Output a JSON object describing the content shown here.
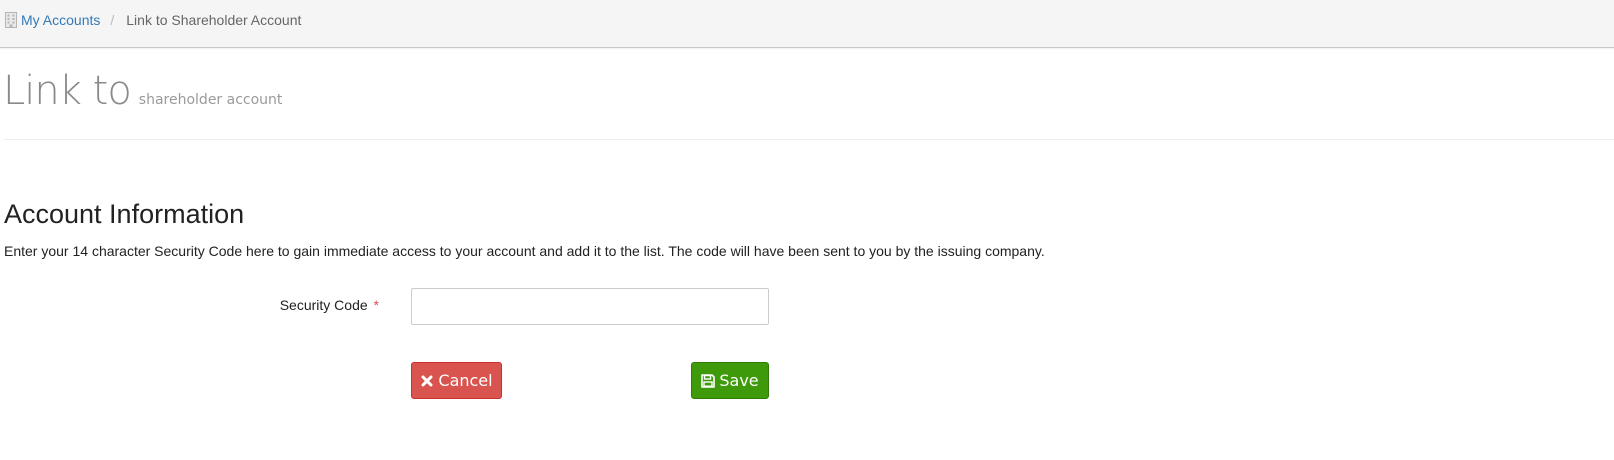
{
  "breadcrumb": {
    "icon": "building-icon",
    "home_label": "My Accounts",
    "separator": "/",
    "current_label": "Link to Shareholder Account"
  },
  "page": {
    "title": "Link to",
    "subtitle": "shareholder account"
  },
  "section": {
    "title": "Account Information",
    "description": "Enter your 14 character Security Code here to gain immediate access to your account and add it to the list. The code will have been sent to you by the issuing company."
  },
  "form": {
    "security_code": {
      "label": "Security Code",
      "required_mark": "*",
      "value": "",
      "placeholder": ""
    }
  },
  "actions": {
    "cancel": {
      "label": "Cancel",
      "icon": "times-icon",
      "color": "#d9534f"
    },
    "save": {
      "label": "Save",
      "icon": "floppy-disk-icon",
      "color": "#3f9a0b"
    }
  },
  "colors": {
    "link": "#337ab7",
    "breadcrumb_bg": "#f5f5f5",
    "required": "#d9534f"
  }
}
